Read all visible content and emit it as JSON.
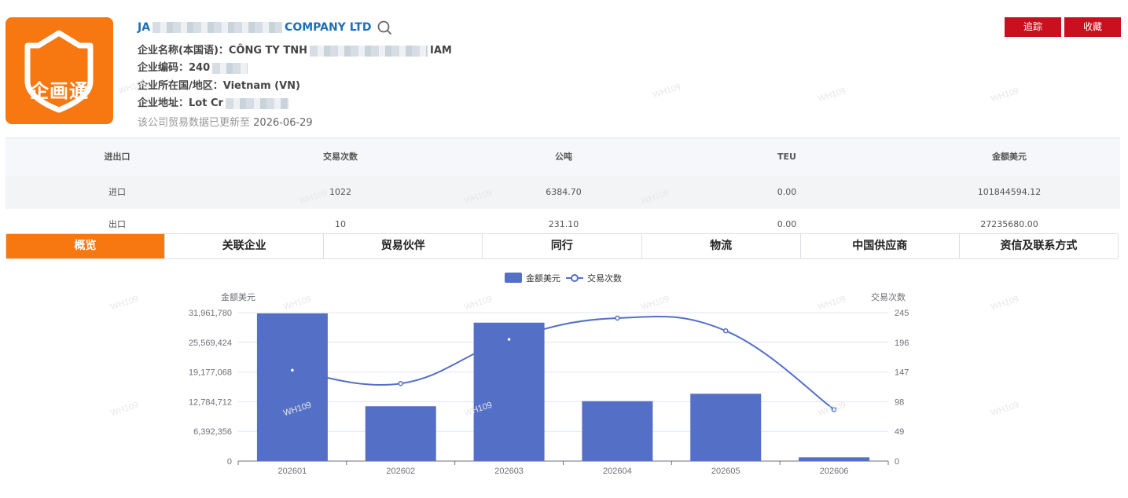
{
  "header": {
    "logo_text": "企画通",
    "company_prefix": "JA",
    "company_suffix": "COMPANY LTD",
    "local_name_label": "企业名称(本国语)：",
    "local_name_prefix": "CÔNG TY TNH",
    "local_name_suffix": "IAM",
    "code_label": "企业编码：",
    "code_value": "240",
    "country_label": "企业所在国/地区：",
    "country_value": "Vietnam (VN)",
    "address_label": "企业地址：",
    "address_value": "Lot Cr",
    "update_text": "该公司贸易数据已更新至",
    "update_date": "2026-06-29"
  },
  "buttons": {
    "track": "追踪",
    "favorite": "收藏"
  },
  "watermark": "WH109",
  "stats": {
    "headers": [
      "进出口",
      "交易次数",
      "公吨",
      "TEU",
      "金额美元"
    ],
    "rows": [
      [
        "进口",
        "1022",
        "6384.70",
        "0.00",
        "101844594.12"
      ],
      [
        "出口",
        "10",
        "231.10",
        "0.00",
        "27235680.00"
      ]
    ]
  },
  "tabs": [
    "概览",
    "关联企业",
    "贸易伙伴",
    "同行",
    "物流",
    "中国供应商",
    "资信及联系方式"
  ],
  "colors": {
    "accent": "#f77711",
    "brand_blue": "#1f6fb5",
    "bar": "#5470c6",
    "button_red": "#c8101e"
  },
  "chart_data": {
    "type": "bar",
    "categories": [
      "202601",
      "202602",
      "202603",
      "202604",
      "202605",
      "202606"
    ],
    "series": [
      {
        "name": "金额美元",
        "type": "bar",
        "axis": "left",
        "values": [
          31800000,
          11800000,
          29800000,
          12900000,
          14500000,
          800000
        ]
      },
      {
        "name": "交易次数",
        "type": "line",
        "axis": "right",
        "smooth": true,
        "values": [
          150,
          128,
          201,
          236,
          215,
          85
        ]
      }
    ],
    "ylabel": "金额美元",
    "y2label": "交易次数",
    "ylim": [
      0,
      31961780
    ],
    "y2lim": [
      0,
      245
    ],
    "yticks": [
      "0",
      "6,392,356",
      "12,784,712",
      "19,177,068",
      "25,569,424",
      "31,961,780"
    ],
    "y2ticks": [
      "0",
      "49",
      "98",
      "147",
      "196",
      "245"
    ],
    "legend": "top-center",
    "grid": true
  }
}
